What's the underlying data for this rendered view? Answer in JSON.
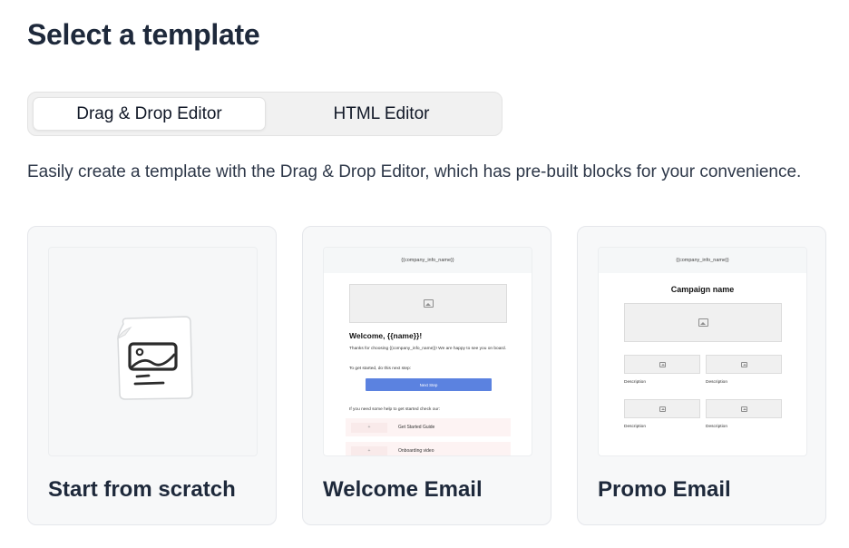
{
  "page": {
    "title": "Select a template",
    "description": "Easily create a template with the Drag & Drop Editor, which has pre-built blocks for your convenience."
  },
  "editor_toggle": {
    "options": [
      {
        "label": "Drag & Drop Editor",
        "selected": true
      },
      {
        "label": "HTML Editor",
        "selected": false
      }
    ]
  },
  "cards": [
    {
      "title": "Start from scratch",
      "icon": "document-image-icon"
    },
    {
      "title": "Welcome Email",
      "preview": {
        "header": "{{company_info_name}}",
        "heading": "Welcome, {{name}}!",
        "paragraph": "Thanks for choosing {{company_info_name}}! We are happy to see you on board.",
        "next_step_text": "To get started, do this next step:",
        "button": "Next Step",
        "help_text": "If you need some help to get started check our:",
        "links": [
          {
            "label": "Get Started Guide",
            "icon": "+"
          },
          {
            "label": "Onboarding video",
            "icon": "+"
          }
        ]
      }
    },
    {
      "title": "Promo Email",
      "preview": {
        "header": "{{company_info_name}}",
        "heading": "Campaign name",
        "descriptions": [
          "Description",
          "Description",
          "Description",
          "Description"
        ]
      }
    }
  ]
}
